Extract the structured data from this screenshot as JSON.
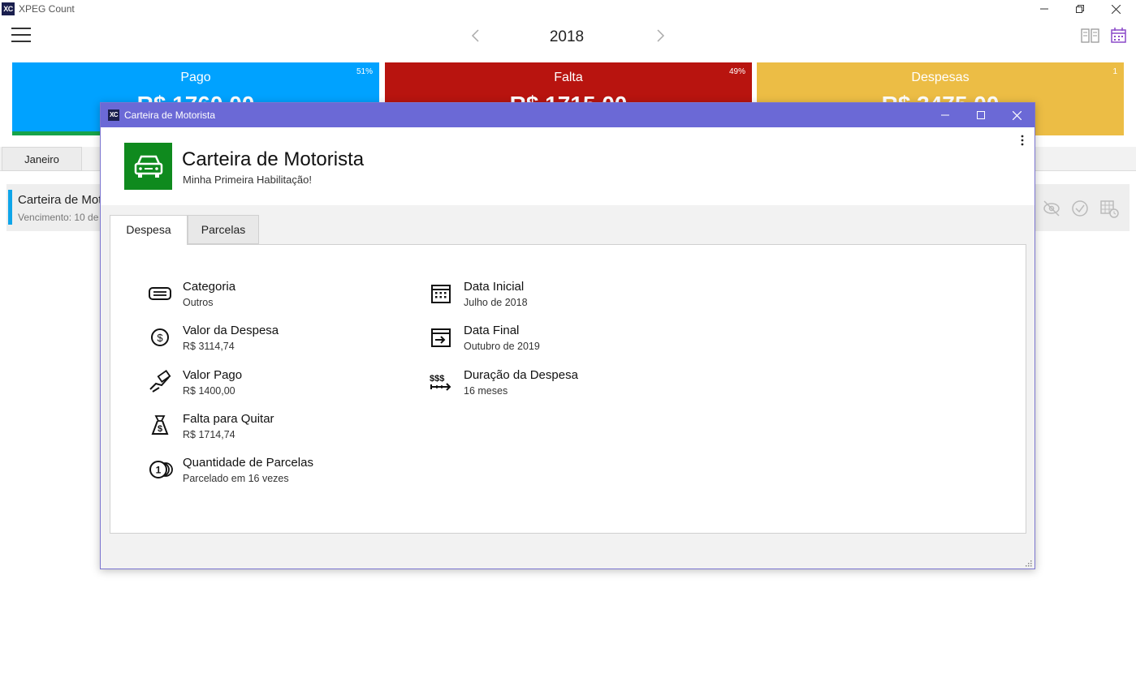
{
  "app": {
    "logo": "XC",
    "title": "XPEG Count"
  },
  "header": {
    "year": "2018",
    "icons": [
      "menu-icon",
      "chevron-left-icon",
      "chevron-right-icon",
      "columns-view-icon",
      "calendar-icon"
    ]
  },
  "cards": [
    {
      "title": "Pago",
      "percent": "51%",
      "amount": "R$ 1760,00",
      "color": "#00a2ff",
      "progress": 0.51
    },
    {
      "title": "Falta",
      "percent": "49%",
      "amount": "R$ 1715,00",
      "color": "#b8140f",
      "progress": 0.49
    },
    {
      "title": "Despesas",
      "percent": "1",
      "amount": "R$ 3475,00",
      "color": "#ecbd45"
    }
  ],
  "months": {
    "active": "Janeiro"
  },
  "list": {
    "item_title": "Carteira de Motorista",
    "item_sub": "Vencimento: 10 de",
    "accent_color": "#0ea5e9"
  },
  "dialog": {
    "logo": "XC",
    "window_title": "Carteira de Motorista",
    "title": "Carteira de Motorista",
    "subtitle": "Minha Primeira Habilitação!",
    "badge_color": "#0f8a1e",
    "titlebar_color": "#6b69d6",
    "tabs": [
      {
        "label": "Despesa",
        "active": true
      },
      {
        "label": "Parcelas",
        "active": false
      }
    ],
    "fields_left": [
      {
        "label": "Categoria",
        "value": "Outros",
        "icon": "category-icon"
      },
      {
        "label": "Valor da Despesa",
        "value": "R$ 3114,74",
        "icon": "dollar-circle-icon"
      },
      {
        "label": "Valor Pago",
        "value": "R$ 1400,00",
        "icon": "hand-money-icon"
      },
      {
        "label": "Falta para Quitar",
        "value": "R$ 1714,74",
        "icon": "money-bag-icon"
      },
      {
        "label": "Quantidade de Parcelas",
        "value": "Parcelado em 16 vezes",
        "icon": "coins-icon"
      }
    ],
    "fields_right": [
      {
        "label": "Data Inicial",
        "value": "Julho de 2018",
        "icon": "calendar-icon"
      },
      {
        "label": "Data Final",
        "value": "Outubro de 2019",
        "icon": "calendar-end-icon"
      },
      {
        "label": "Duração da Despesa",
        "value": "16 meses",
        "icon": "duration-icon"
      }
    ]
  }
}
